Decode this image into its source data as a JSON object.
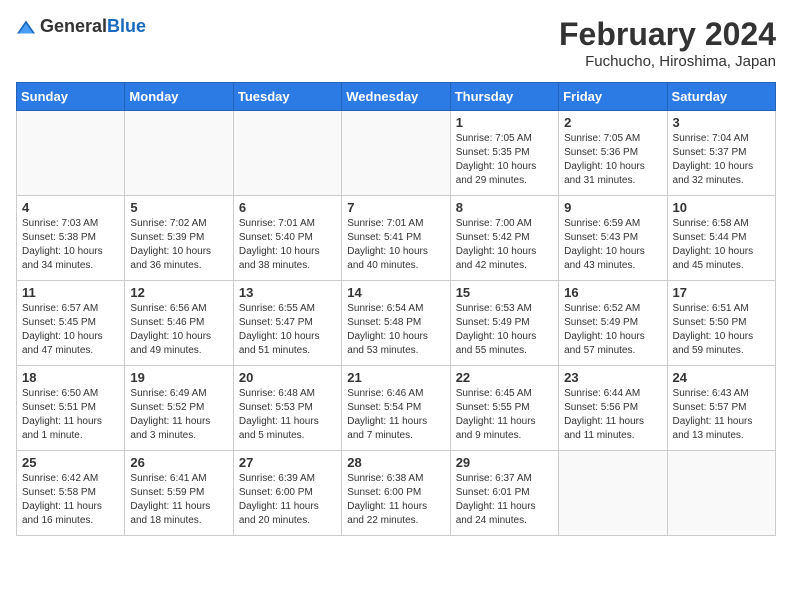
{
  "header": {
    "logo_general": "General",
    "logo_blue": "Blue",
    "month_title": "February 2024",
    "location": "Fuchucho, Hiroshima, Japan"
  },
  "days_of_week": [
    "Sunday",
    "Monday",
    "Tuesday",
    "Wednesday",
    "Thursday",
    "Friday",
    "Saturday"
  ],
  "weeks": [
    {
      "days": [
        {
          "num": "",
          "info": ""
        },
        {
          "num": "",
          "info": ""
        },
        {
          "num": "",
          "info": ""
        },
        {
          "num": "",
          "info": ""
        },
        {
          "num": "1",
          "info": "Sunrise: 7:05 AM\nSunset: 5:35 PM\nDaylight: 10 hours\nand 29 minutes."
        },
        {
          "num": "2",
          "info": "Sunrise: 7:05 AM\nSunset: 5:36 PM\nDaylight: 10 hours\nand 31 minutes."
        },
        {
          "num": "3",
          "info": "Sunrise: 7:04 AM\nSunset: 5:37 PM\nDaylight: 10 hours\nand 32 minutes."
        }
      ]
    },
    {
      "days": [
        {
          "num": "4",
          "info": "Sunrise: 7:03 AM\nSunset: 5:38 PM\nDaylight: 10 hours\nand 34 minutes."
        },
        {
          "num": "5",
          "info": "Sunrise: 7:02 AM\nSunset: 5:39 PM\nDaylight: 10 hours\nand 36 minutes."
        },
        {
          "num": "6",
          "info": "Sunrise: 7:01 AM\nSunset: 5:40 PM\nDaylight: 10 hours\nand 38 minutes."
        },
        {
          "num": "7",
          "info": "Sunrise: 7:01 AM\nSunset: 5:41 PM\nDaylight: 10 hours\nand 40 minutes."
        },
        {
          "num": "8",
          "info": "Sunrise: 7:00 AM\nSunset: 5:42 PM\nDaylight: 10 hours\nand 42 minutes."
        },
        {
          "num": "9",
          "info": "Sunrise: 6:59 AM\nSunset: 5:43 PM\nDaylight: 10 hours\nand 43 minutes."
        },
        {
          "num": "10",
          "info": "Sunrise: 6:58 AM\nSunset: 5:44 PM\nDaylight: 10 hours\nand 45 minutes."
        }
      ]
    },
    {
      "days": [
        {
          "num": "11",
          "info": "Sunrise: 6:57 AM\nSunset: 5:45 PM\nDaylight: 10 hours\nand 47 minutes."
        },
        {
          "num": "12",
          "info": "Sunrise: 6:56 AM\nSunset: 5:46 PM\nDaylight: 10 hours\nand 49 minutes."
        },
        {
          "num": "13",
          "info": "Sunrise: 6:55 AM\nSunset: 5:47 PM\nDaylight: 10 hours\nand 51 minutes."
        },
        {
          "num": "14",
          "info": "Sunrise: 6:54 AM\nSunset: 5:48 PM\nDaylight: 10 hours\nand 53 minutes."
        },
        {
          "num": "15",
          "info": "Sunrise: 6:53 AM\nSunset: 5:49 PM\nDaylight: 10 hours\nand 55 minutes."
        },
        {
          "num": "16",
          "info": "Sunrise: 6:52 AM\nSunset: 5:49 PM\nDaylight: 10 hours\nand 57 minutes."
        },
        {
          "num": "17",
          "info": "Sunrise: 6:51 AM\nSunset: 5:50 PM\nDaylight: 10 hours\nand 59 minutes."
        }
      ]
    },
    {
      "days": [
        {
          "num": "18",
          "info": "Sunrise: 6:50 AM\nSunset: 5:51 PM\nDaylight: 11 hours\nand 1 minute."
        },
        {
          "num": "19",
          "info": "Sunrise: 6:49 AM\nSunset: 5:52 PM\nDaylight: 11 hours\nand 3 minutes."
        },
        {
          "num": "20",
          "info": "Sunrise: 6:48 AM\nSunset: 5:53 PM\nDaylight: 11 hours\nand 5 minutes."
        },
        {
          "num": "21",
          "info": "Sunrise: 6:46 AM\nSunset: 5:54 PM\nDaylight: 11 hours\nand 7 minutes."
        },
        {
          "num": "22",
          "info": "Sunrise: 6:45 AM\nSunset: 5:55 PM\nDaylight: 11 hours\nand 9 minutes."
        },
        {
          "num": "23",
          "info": "Sunrise: 6:44 AM\nSunset: 5:56 PM\nDaylight: 11 hours\nand 11 minutes."
        },
        {
          "num": "24",
          "info": "Sunrise: 6:43 AM\nSunset: 5:57 PM\nDaylight: 11 hours\nand 13 minutes."
        }
      ]
    },
    {
      "days": [
        {
          "num": "25",
          "info": "Sunrise: 6:42 AM\nSunset: 5:58 PM\nDaylight: 11 hours\nand 16 minutes."
        },
        {
          "num": "26",
          "info": "Sunrise: 6:41 AM\nSunset: 5:59 PM\nDaylight: 11 hours\nand 18 minutes."
        },
        {
          "num": "27",
          "info": "Sunrise: 6:39 AM\nSunset: 6:00 PM\nDaylight: 11 hours\nand 20 minutes."
        },
        {
          "num": "28",
          "info": "Sunrise: 6:38 AM\nSunset: 6:00 PM\nDaylight: 11 hours\nand 22 minutes."
        },
        {
          "num": "29",
          "info": "Sunrise: 6:37 AM\nSunset: 6:01 PM\nDaylight: 11 hours\nand 24 minutes."
        },
        {
          "num": "",
          "info": ""
        },
        {
          "num": "",
          "info": ""
        }
      ]
    }
  ]
}
